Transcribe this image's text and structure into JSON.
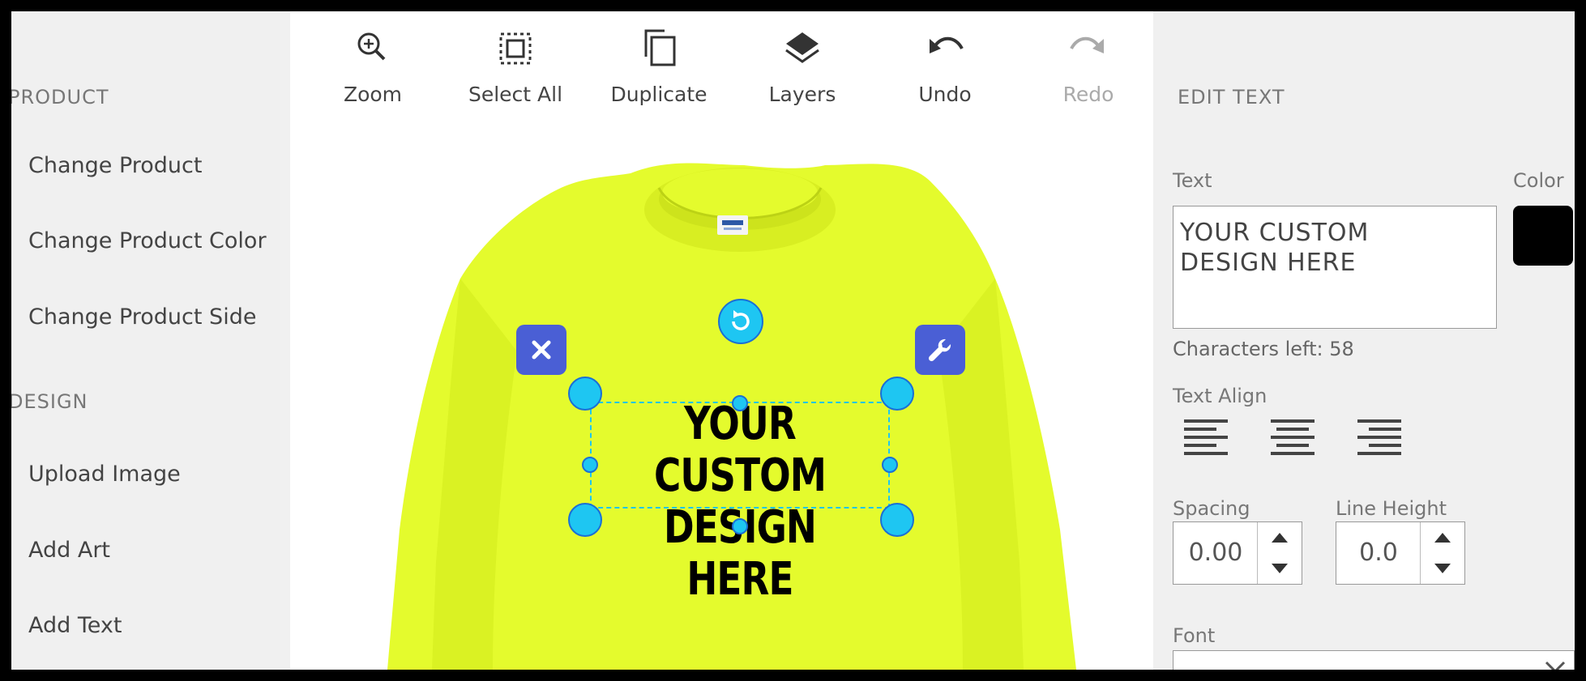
{
  "sidebar": {
    "product_title": "PRODUCT",
    "product_items": [
      "Change Product",
      "Change Product Color",
      "Change Product Side"
    ],
    "design_title": "DESIGN",
    "design_items": [
      "Upload Image",
      "Add Art",
      "Add Text"
    ]
  },
  "toolbar": {
    "zoom": "Zoom",
    "select_all": "Select All",
    "duplicate": "Duplicate",
    "layers": "Layers",
    "undo": "Undo",
    "redo": "Redo"
  },
  "canvas": {
    "product_color": "#e4fb2d",
    "design_text_line1": "YOUR CUSTOM",
    "design_text_line2": "DESIGN HERE",
    "handle_color": "#1ec6f2",
    "button_color": "#4a5fd5"
  },
  "panel": {
    "title": "EDIT TEXT",
    "text_label": "Text",
    "color_label": "Color",
    "text_value_line1": "YOUR CUSTOM",
    "text_value_line2": "DESIGN HERE",
    "text_color": "#000000",
    "characters_left": "Characters left: 58",
    "text_align_label": "Text Align",
    "spacing_label": "Spacing",
    "spacing_value": "0.00",
    "line_height_label": "Line Height",
    "line_height_value": "0.0",
    "font_label": "Font"
  }
}
